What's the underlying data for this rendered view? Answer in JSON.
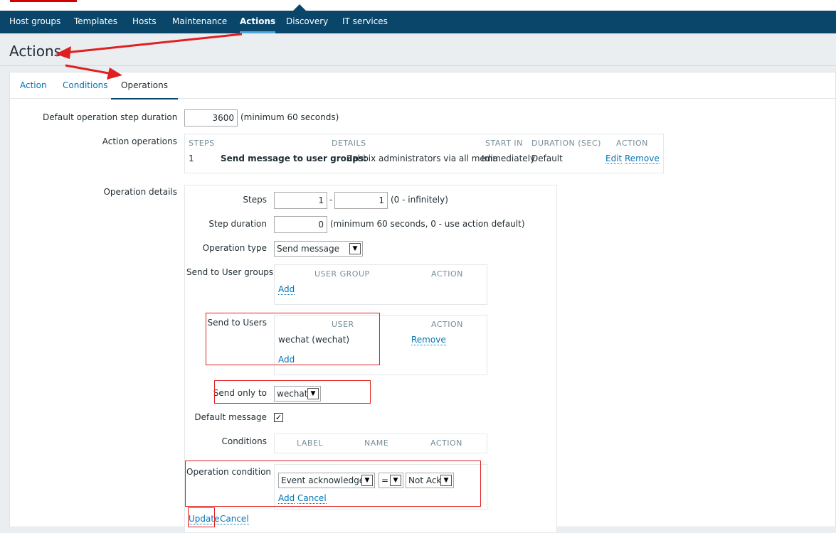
{
  "topnav": {
    "items": [
      {
        "label": "Host groups"
      },
      {
        "label": "Templates"
      },
      {
        "label": "Hosts"
      },
      {
        "label": "Maintenance"
      },
      {
        "label": "Actions",
        "active": true
      },
      {
        "label": "Discovery"
      },
      {
        "label": "IT services"
      }
    ]
  },
  "page": {
    "title": "Actions"
  },
  "tabs": [
    {
      "label": "Action"
    },
    {
      "label": "Conditions"
    },
    {
      "label": "Operations",
      "active": true
    }
  ],
  "form": {
    "default_step_duration_label": "Default operation step duration",
    "default_step_duration_value": "3600",
    "default_step_duration_hint": "(minimum 60 seconds)",
    "action_operations_label": "Action operations",
    "ops_table": {
      "headers": {
        "steps": "STEPS",
        "details": "DETAILS",
        "start_in": "START IN",
        "duration": "DURATION (SEC)",
        "action": "ACTION"
      },
      "rows": [
        {
          "steps": "1",
          "details_bold": "Send message to user groups:",
          "details_rest": "Zabbix administrators via all media",
          "start_in": "Immediately",
          "duration": "Default",
          "edit": "Edit",
          "remove": "Remove"
        }
      ]
    },
    "operation_details_label": "Operation details",
    "details": {
      "steps_label": "Steps",
      "steps_from": "1",
      "steps_sep": "-",
      "steps_to": "1",
      "steps_hint": "(0 - infinitely)",
      "step_duration_label": "Step duration",
      "step_duration_value": "0",
      "step_duration_hint": "(minimum 60 seconds, 0 - use action default)",
      "operation_type_label": "Operation type",
      "operation_type_value": "Send message",
      "send_groups_label": "Send to User groups",
      "groups_header_user_group": "USER GROUP",
      "groups_header_action": "ACTION",
      "groups_add": "Add",
      "send_users_label": "Send to Users",
      "users_header_user": "USER",
      "users_header_action": "ACTION",
      "users_row_user": "wechat (wechat)",
      "users_row_remove": "Remove",
      "users_add": "Add",
      "send_only_label": "Send only to",
      "send_only_value": "wechat",
      "default_message_label": "Default message",
      "default_message_checked": true,
      "conditions_label": "Conditions",
      "cond_header_label": "LABEL",
      "cond_header_name": "NAME",
      "cond_header_action": "ACTION",
      "op_condition_label": "Operation condition",
      "op_condition_type": "Event acknowledged",
      "op_condition_operator": "=",
      "op_condition_value": "Not Ack",
      "op_condition_add": "Add",
      "op_condition_cancel": "Cancel",
      "update": "Update",
      "cancel": "Cancel"
    }
  },
  "colors": {
    "nav_bg": "#0a466a",
    "link": "#0275b8",
    "annotation_red": "#e02020"
  }
}
